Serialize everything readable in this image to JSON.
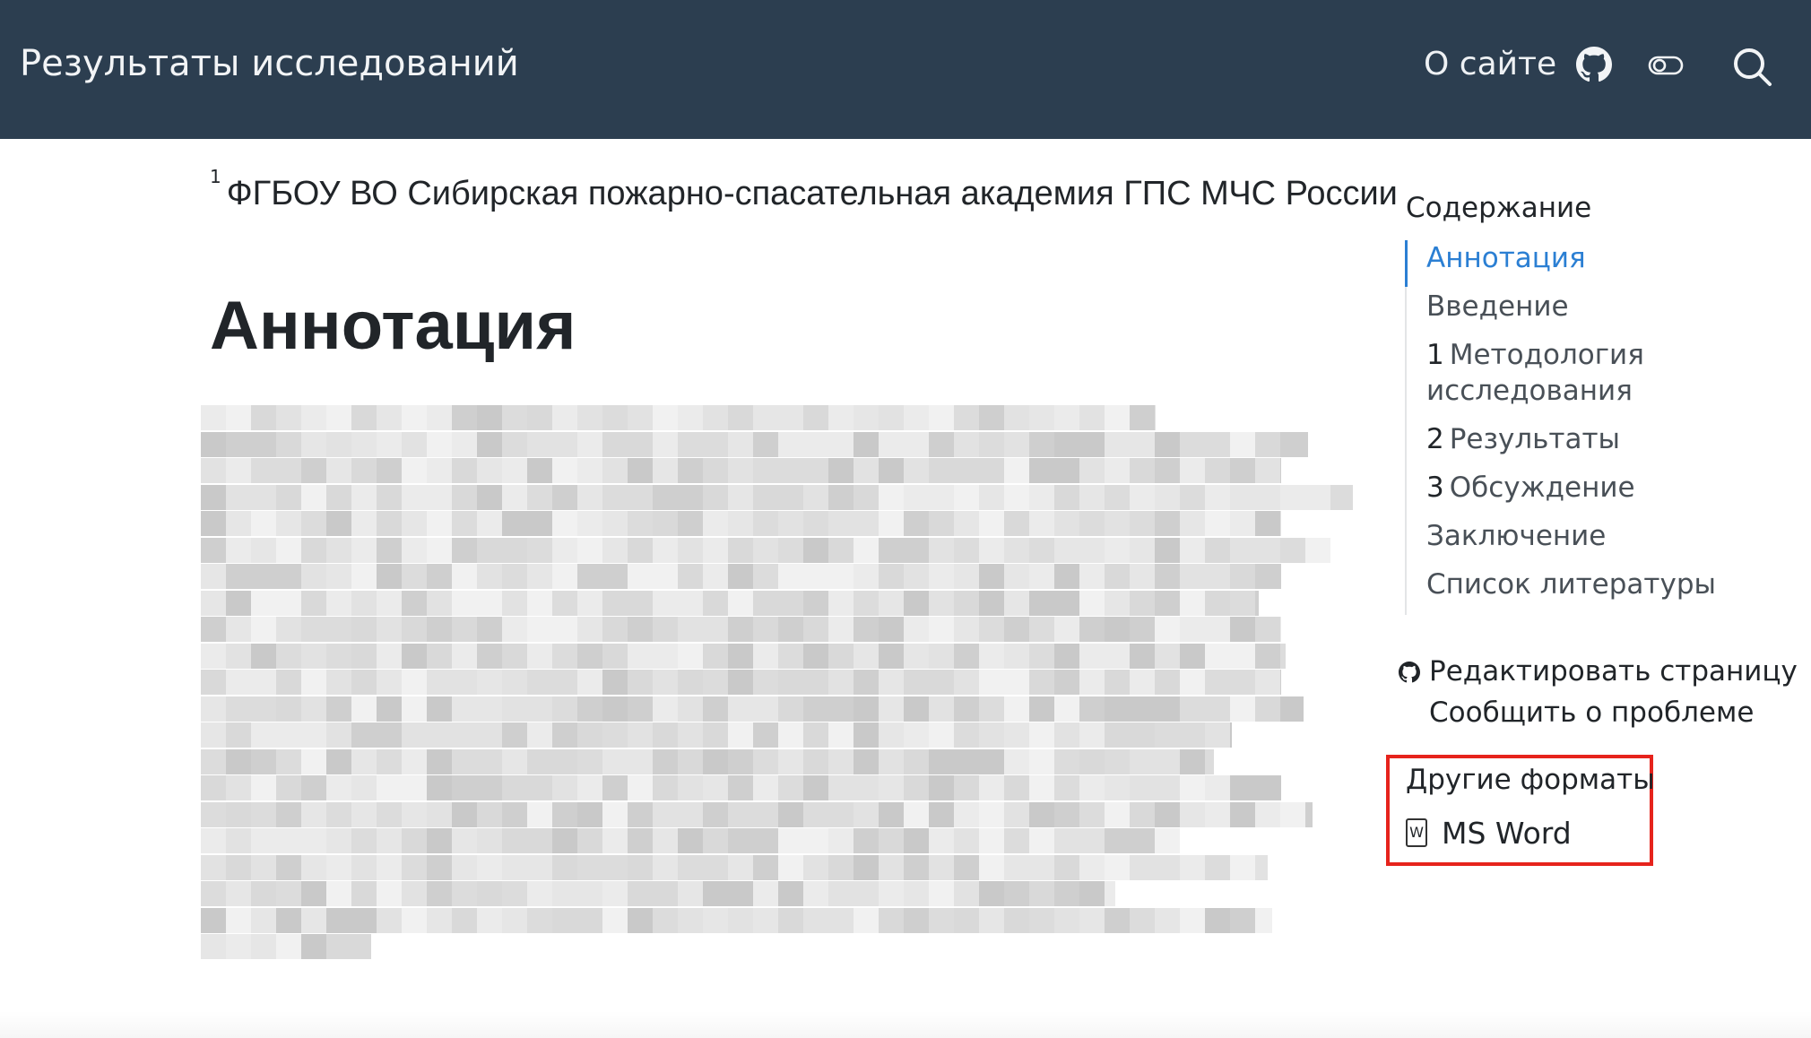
{
  "navbar": {
    "title": "Результаты исследований",
    "about": "О сайте",
    "icons": [
      "github-icon",
      "toggle-icon",
      "search-icon"
    ]
  },
  "article": {
    "affiliation_mark": "1",
    "affiliation": "ФГБОУ ВО Сибирская пожарно-спасательная академия ГПС МЧС России",
    "heading": "Аннотация"
  },
  "toc": {
    "title": "Содержание",
    "items": [
      {
        "num": "",
        "label": "Аннотация"
      },
      {
        "num": "",
        "label": "Введение"
      },
      {
        "num": "1",
        "label": "Методология исследования"
      },
      {
        "num": "2",
        "label": "Результаты"
      },
      {
        "num": "3",
        "label": "Обсуждение"
      },
      {
        "num": "",
        "label": "Заключение"
      },
      {
        "num": "",
        "label": "Список литературы"
      }
    ]
  },
  "page_actions": {
    "edit": "Редактировать страницу",
    "issue": "Сообщить о проблеме"
  },
  "other_formats": {
    "title": "Другие форматы",
    "word_icon_letter": "W",
    "word": "MS Word"
  },
  "colors": {
    "navbar": "#2c3e50",
    "toc_active": "#2b7fd3",
    "highlight": "#e6231c"
  }
}
